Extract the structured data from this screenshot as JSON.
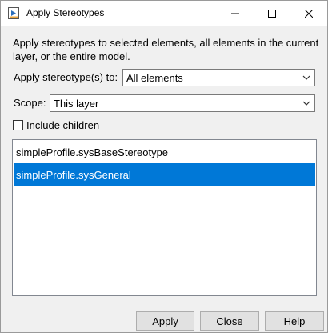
{
  "window": {
    "title": "Apply Stereotypes"
  },
  "description": "Apply stereotypes to selected elements, all elements in the current layer, or the entire model.",
  "apply_stereotypes_to": {
    "label": "Apply stereotype(s) to:",
    "selected": "All elements"
  },
  "scope": {
    "label": "Scope:",
    "selected": "This layer"
  },
  "include_children": {
    "label": "Include children",
    "checked": false
  },
  "stereotype_list": {
    "items": [
      {
        "label": "simpleProfile.sysBaseStereotype",
        "selected": false
      },
      {
        "label": "simpleProfile.sysGeneral",
        "selected": true
      }
    ]
  },
  "buttons": {
    "apply": "Apply",
    "close": "Close",
    "help": "Help"
  },
  "colors": {
    "selection": "#0078d7",
    "dialog_bg": "#f0f0f0"
  }
}
